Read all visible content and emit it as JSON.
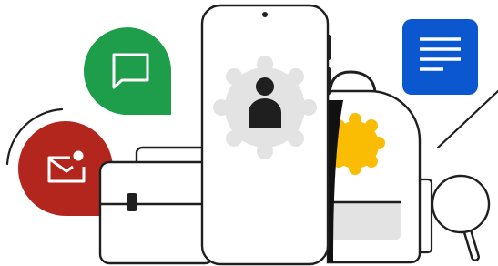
{
  "scene": {
    "phone": {
      "icon": "person-icon",
      "badge_color": "#e3e3e3",
      "icon_color": "#1f1f1f"
    },
    "chat_bubble": {
      "icon": "message-icon",
      "color": "#1e9e4a"
    },
    "mail_bubble": {
      "icon": "mail-notification-icon",
      "color": "#b3261e"
    },
    "document_tile": {
      "icon": "document-lines-icon",
      "color": "#0b57d0"
    },
    "backpack": {
      "accent_color": "#fbbc04",
      "pocket_color": "#e3e3e3",
      "side_color": "#111111"
    },
    "briefcase": {
      "icon": "briefcase-icon"
    },
    "magnifier": {
      "icon": "magnifying-glass-icon"
    },
    "stroke_color": "#1f1f1f"
  }
}
